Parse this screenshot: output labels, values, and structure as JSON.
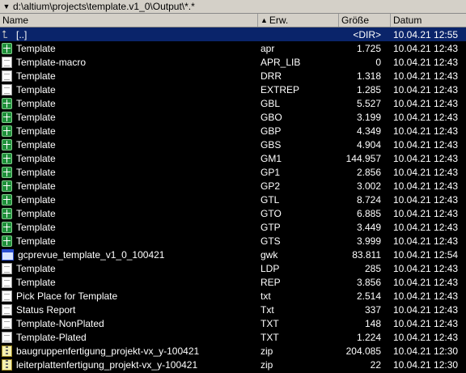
{
  "path": "d:\\altium\\projects\\template.v1_0\\Output\\*.*",
  "columns": {
    "name": "Name",
    "ext": "Erw.",
    "size": "Größe",
    "date": "Datum"
  },
  "files": [
    {
      "name": "[..]",
      "ext": "",
      "size": "<DIR>",
      "date": "10.04.21 12:55",
      "icon": "folder-up-icon",
      "selected": true
    },
    {
      "name": "Template",
      "ext": "apr",
      "size": "1.725",
      "date": "10.04.21 12:43",
      "icon": "gerber-icon"
    },
    {
      "name": "Template-macro",
      "ext": "APR_LIB",
      "size": "0",
      "date": "10.04.21 12:43",
      "icon": "document-icon"
    },
    {
      "name": "Template",
      "ext": "DRR",
      "size": "1.318",
      "date": "10.04.21 12:43",
      "icon": "document-icon"
    },
    {
      "name": "Template",
      "ext": "EXTREP",
      "size": "1.285",
      "date": "10.04.21 12:43",
      "icon": "document-icon"
    },
    {
      "name": "Template",
      "ext": "GBL",
      "size": "5.527",
      "date": "10.04.21 12:43",
      "icon": "gerber-icon"
    },
    {
      "name": "Template",
      "ext": "GBO",
      "size": "3.199",
      "date": "10.04.21 12:43",
      "icon": "gerber-icon"
    },
    {
      "name": "Template",
      "ext": "GBP",
      "size": "4.349",
      "date": "10.04.21 12:43",
      "icon": "gerber-icon"
    },
    {
      "name": "Template",
      "ext": "GBS",
      "size": "4.904",
      "date": "10.04.21 12:43",
      "icon": "gerber-icon"
    },
    {
      "name": "Template",
      "ext": "GM1",
      "size": "144.957",
      "date": "10.04.21 12:43",
      "icon": "gerber-icon"
    },
    {
      "name": "Template",
      "ext": "GP1",
      "size": "2.856",
      "date": "10.04.21 12:43",
      "icon": "gerber-icon"
    },
    {
      "name": "Template",
      "ext": "GP2",
      "size": "3.002",
      "date": "10.04.21 12:43",
      "icon": "gerber-icon"
    },
    {
      "name": "Template",
      "ext": "GTL",
      "size": "8.724",
      "date": "10.04.21 12:43",
      "icon": "gerber-icon"
    },
    {
      "name": "Template",
      "ext": "GTO",
      "size": "6.885",
      "date": "10.04.21 12:43",
      "icon": "gerber-icon"
    },
    {
      "name": "Template",
      "ext": "GTP",
      "size": "3.449",
      "date": "10.04.21 12:43",
      "icon": "gerber-icon"
    },
    {
      "name": "Template",
      "ext": "GTS",
      "size": "3.999",
      "date": "10.04.21 12:43",
      "icon": "gerber-icon"
    },
    {
      "name": "gcprevue_template_v1_0_100421",
      "ext": "gwk",
      "size": "83.811",
      "date": "10.04.21 12:54",
      "icon": "gcprevue-icon"
    },
    {
      "name": "Template",
      "ext": "LDP",
      "size": "285",
      "date": "10.04.21 12:43",
      "icon": "document-icon"
    },
    {
      "name": "Template",
      "ext": "REP",
      "size": "3.856",
      "date": "10.04.21 12:43",
      "icon": "document-icon"
    },
    {
      "name": "Pick Place for Template",
      "ext": "txt",
      "size": "2.514",
      "date": "10.04.21 12:43",
      "icon": "document-icon"
    },
    {
      "name": "Status Report",
      "ext": "Txt",
      "size": "337",
      "date": "10.04.21 12:43",
      "icon": "document-icon"
    },
    {
      "name": "Template-NonPlated",
      "ext": "TXT",
      "size": "148",
      "date": "10.04.21 12:43",
      "icon": "document-icon"
    },
    {
      "name": "Template-Plated",
      "ext": "TXT",
      "size": "1.224",
      "date": "10.04.21 12:43",
      "icon": "document-icon"
    },
    {
      "name": "baugruppenfertigung_projekt-vx_y-100421",
      "ext": "zip",
      "size": "204.085",
      "date": "10.04.21 12:30",
      "icon": "zip-icon"
    },
    {
      "name": "leiterplattenfertigung_projekt-vx_y-100421",
      "ext": "zip",
      "size": "22",
      "date": "10.04.21 12:30",
      "icon": "zip-icon"
    }
  ]
}
